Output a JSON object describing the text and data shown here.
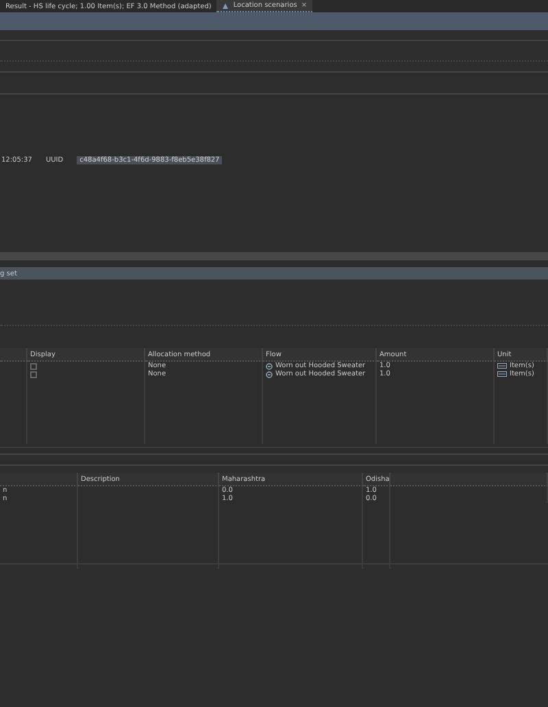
{
  "tabs": [
    {
      "label": "Result - HS life cycle; 1.00 Item(s); EF 3.0 Method (adapted)",
      "selected": false
    },
    {
      "label": "Location scenarios",
      "selected": true,
      "close": "×"
    }
  ],
  "info": {
    "time": "12:05:37",
    "uuid_label": "UUID",
    "uuid": "c48a4f68-b3c1-4f6d-9883-f8eb5e38f827"
  },
  "section": {
    "title": "g set"
  },
  "allocation_table": {
    "columns": [
      "Display",
      "Allocation method",
      "Flow",
      "Amount",
      "Unit"
    ],
    "rows": [
      {
        "checked": false,
        "method": "None",
        "flow": "Worn out Hooded Sweater",
        "amount": "1.0",
        "unit": "Item(s)"
      },
      {
        "checked": false,
        "method": "None",
        "flow": "Worn out Hooded Sweater",
        "amount": "1.0",
        "unit": "Item(s)"
      }
    ]
  },
  "scenario_table": {
    "columns": [
      "Description",
      "Maharashtra",
      "Odisha"
    ],
    "rows": [
      {
        "column_1": "n",
        "values": [
          "0.0",
          "1.0"
        ]
      },
      {
        "column_1": "n",
        "values": [
          "1.0",
          "0.0"
        ]
      }
    ]
  }
}
